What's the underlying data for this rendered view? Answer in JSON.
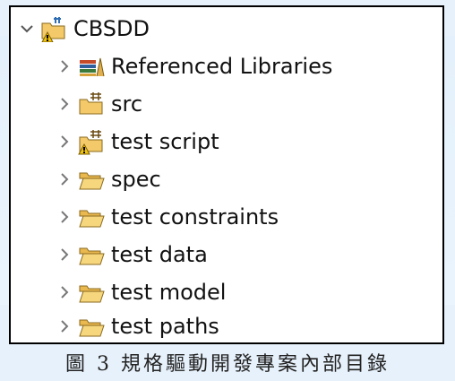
{
  "tree": {
    "root": {
      "label": "CBSDD",
      "expand_icon": "chevron-down-icon",
      "icon": "java-project-warning-icon"
    },
    "items": [
      {
        "label": "Referenced Libraries",
        "icon": "library-books-icon",
        "expand_icon": "chevron-right-icon"
      },
      {
        "label": "src",
        "icon": "source-folder-icon",
        "expand_icon": "chevron-right-icon"
      },
      {
        "label": "test script",
        "icon": "source-folder-warning-icon",
        "expand_icon": "chevron-right-icon"
      },
      {
        "label": "spec",
        "icon": "folder-icon",
        "expand_icon": "chevron-right-icon"
      },
      {
        "label": "test constraints",
        "icon": "folder-icon",
        "expand_icon": "chevron-right-icon"
      },
      {
        "label": "test data",
        "icon": "folder-icon",
        "expand_icon": "chevron-right-icon"
      },
      {
        "label": "test model",
        "icon": "folder-icon",
        "expand_icon": "chevron-right-icon"
      },
      {
        "label": "test paths",
        "icon": "folder-icon",
        "expand_icon": "chevron-right-icon"
      }
    ]
  },
  "caption": "圖 3 規格驅動開發專案內部目錄"
}
